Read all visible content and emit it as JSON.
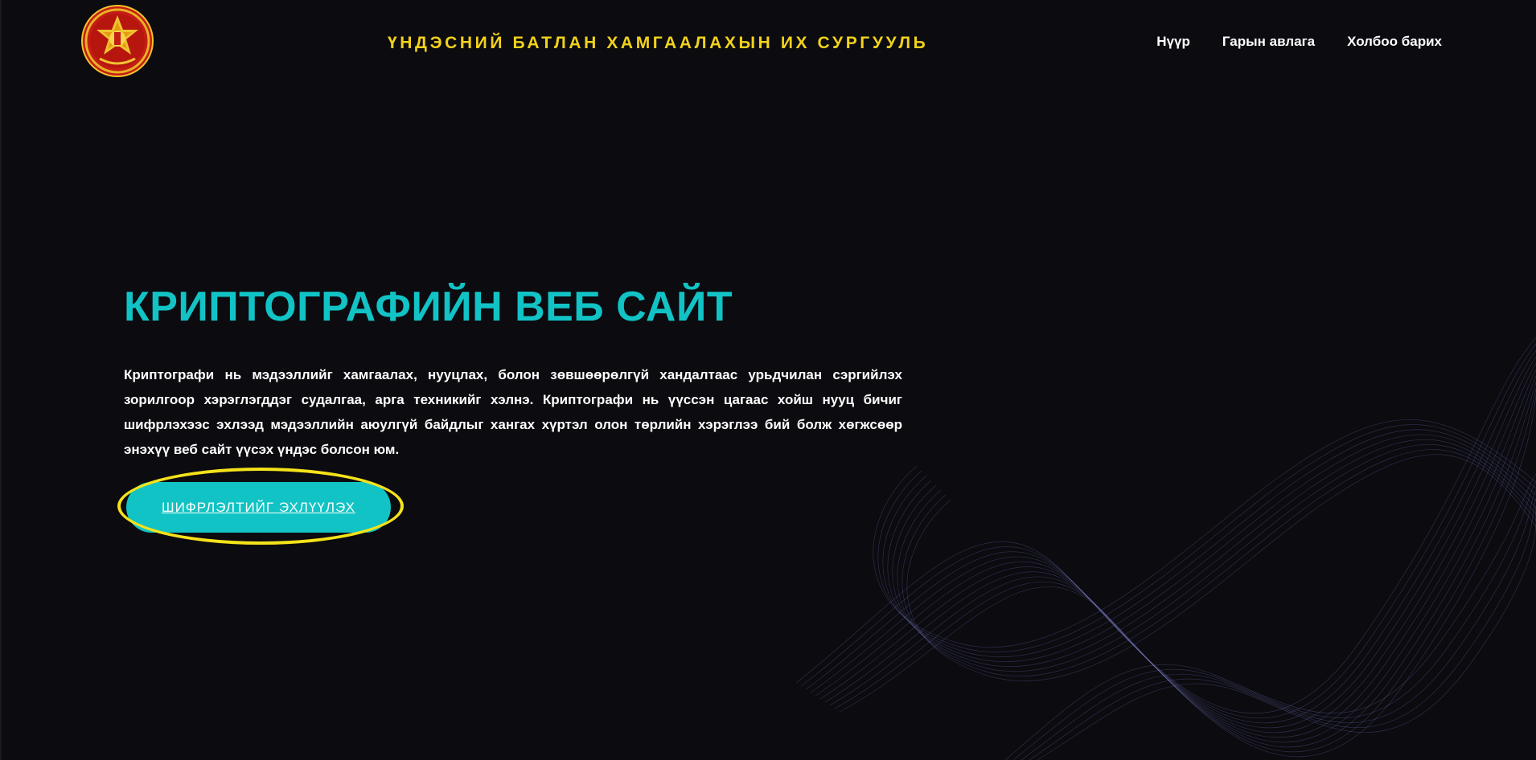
{
  "header": {
    "logo_icon": "university-emblem-icon",
    "title": "ҮНДЭСНИЙ БАТЛАН ХАМГААЛАХЫН ИХ СУРГУУЛЬ",
    "nav": [
      {
        "label": "Нүүр"
      },
      {
        "label": "Гарын авлага"
      },
      {
        "label": "Холбоо барих"
      }
    ]
  },
  "hero": {
    "title": "КРИПТОГРАФИЙН ВЕБ САЙТ",
    "description": "Криптографи нь мэдээллийг хамгаалах, нууцлах, болон зөвшөөрөлгүй хандалтаас урьдчилан сэргийлэх зорилгоор хэрэглэгддэг судалгаа, арга техникийг хэлнэ. Криптографи нь үүссэн цагаас хойш нууц бичиг шифрлэхээс эхлээд мэдээллийн аюулгүй байдлыг хангах хүртэл олон төрлийн хэрэглээ бий болж хөгжсөөр энэхүү веб сайт үүсэх үндэс болсон юм.",
    "cta_label": "ШИФРЛЭЛТИЙГ ЭХЛҮҮЛЭХ"
  },
  "colors": {
    "background": "#0b0b10",
    "title_yellow": "#f2d21b",
    "accent_teal": "#12c3c5",
    "highlight_yellow": "#f5e21a",
    "wave_purple": "#8a88d8"
  },
  "decor": {
    "background_icon": "abstract-wave-lines-icon"
  }
}
